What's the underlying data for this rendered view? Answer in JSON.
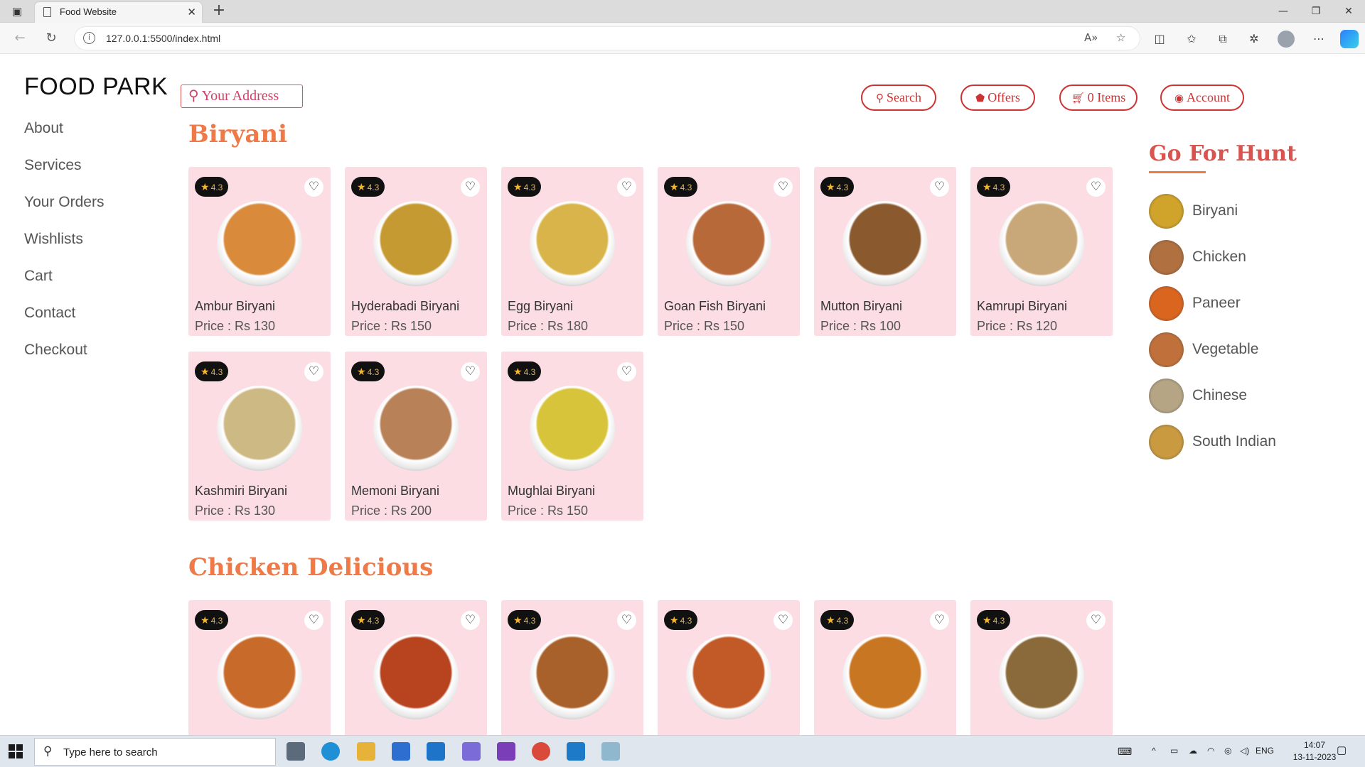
{
  "browser": {
    "tab_title": "Food Website",
    "url": "127.0.0.1:5500/index.html"
  },
  "site": {
    "logo": "FOOD PARK",
    "nav": [
      "About",
      "Services",
      "Your Orders",
      "Wishlists",
      "Cart",
      "Contact",
      "Checkout"
    ],
    "address_placeholder": "Your Address",
    "buttons": {
      "search": "Search",
      "offers": "Offers",
      "cart": "0 Items",
      "account": "Account"
    }
  },
  "sections": [
    {
      "title": "Biryani",
      "items": [
        {
          "rating": "4.3",
          "name": "Ambur Biryani",
          "price": "Price : Rs 130",
          "color": "#d98a3a"
        },
        {
          "rating": "4.3",
          "name": "Hyderabadi Biryani",
          "price": "Price : Rs 150",
          "color": "#c69a32"
        },
        {
          "rating": "4.3",
          "name": "Egg Biryani",
          "price": "Price : Rs 180",
          "color": "#d9b44a"
        },
        {
          "rating": "4.3",
          "name": "Goan Fish Biryani",
          "price": "Price : Rs 150",
          "color": "#b8693a"
        },
        {
          "rating": "4.3",
          "name": "Mutton Biryani",
          "price": "Price : Rs 100",
          "color": "#8a5a2e"
        },
        {
          "rating": "4.3",
          "name": "Kamrupi Biryani",
          "price": "Price : Rs 120",
          "color": "#c8a878"
        },
        {
          "rating": "4.3",
          "name": "Kashmiri Biryani",
          "price": "Price : Rs 130",
          "color": "#cdb983"
        },
        {
          "rating": "4.3",
          "name": "Memoni Biryani",
          "price": "Price : Rs 200",
          "color": "#b88158"
        },
        {
          "rating": "4.3",
          "name": "Mughlai Biryani",
          "price": "Price : Rs 150",
          "color": "#d7c43a"
        }
      ]
    },
    {
      "title": "Chicken Delicious",
      "items": [
        {
          "rating": "4.3",
          "color": "#c86a2a"
        },
        {
          "rating": "4.3",
          "color": "#b8431f"
        },
        {
          "rating": "4.3",
          "color": "#a8612a"
        },
        {
          "rating": "4.3",
          "color": "#c25a28"
        },
        {
          "rating": "4.3",
          "color": "#c97622"
        },
        {
          "rating": "4.3",
          "color": "#8a6a3a"
        }
      ]
    }
  ],
  "hunt": {
    "title": "Go For Hunt",
    "items": [
      {
        "label": "Biryani",
        "color": "#d0a32a"
      },
      {
        "label": "Chicken",
        "color": "#b07040"
      },
      {
        "label": "Paneer",
        "color": "#d9651f"
      },
      {
        "label": "Vegetable",
        "color": "#c0703a"
      },
      {
        "label": "Chinese",
        "color": "#b5a585"
      },
      {
        "label": "South Indian",
        "color": "#c99a40"
      }
    ]
  },
  "taskbar": {
    "search_placeholder": "Type here to search",
    "lang": "ENG",
    "time": "14:07",
    "date": "13-11-2023"
  }
}
